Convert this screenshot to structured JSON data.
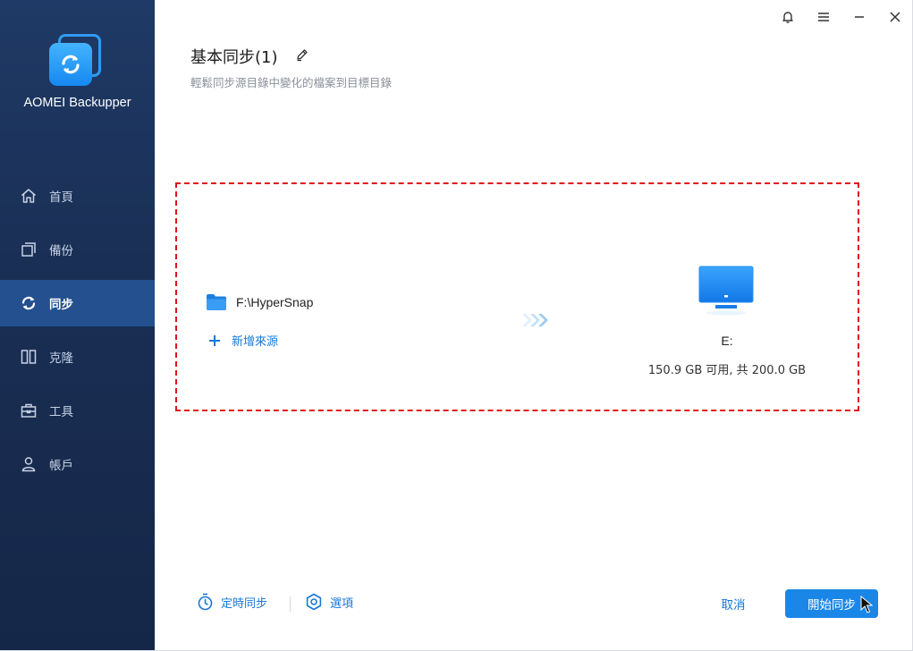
{
  "app": {
    "name": "AOMEI Backupper"
  },
  "sidebar": {
    "items": [
      {
        "label": "首頁",
        "icon": "home-icon",
        "active": false
      },
      {
        "label": "備份",
        "icon": "backup-icon",
        "active": false
      },
      {
        "label": "同步",
        "icon": "sync-icon",
        "active": true
      },
      {
        "label": "克隆",
        "icon": "clone-icon",
        "active": false
      },
      {
        "label": "工具",
        "icon": "tools-icon",
        "active": false
      },
      {
        "label": "帳戶",
        "icon": "account-icon",
        "active": false
      }
    ]
  },
  "header": {
    "title": "基本同步(1)",
    "subtitle": "輕鬆同步源目錄中變化的檔案到目標目錄"
  },
  "source": {
    "path": "F:\\HyperSnap",
    "add_label": "新增來源"
  },
  "destination": {
    "drive": "E:",
    "space": "150.9 GB 可用, 共 200.0 GB"
  },
  "footer": {
    "schedule_label": "定時同步",
    "options_label": "選項",
    "cancel_label": "取消",
    "start_label": "開始同步"
  },
  "colors": {
    "sidebar_bg": "#1a2f55",
    "sidebar_active": "#24508f",
    "accent": "#1a87e8",
    "dashed_border": "#e0101a"
  }
}
